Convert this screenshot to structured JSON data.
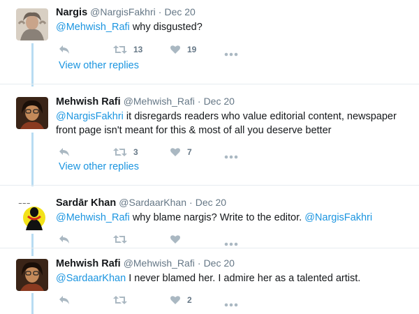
{
  "tweets": [
    {
      "name": "Nargis",
      "handle": "@NargisFakhri",
      "date": "Dec 20",
      "text_mention": "@Mehwish_Rafi",
      "text_rest": " why disgusted?",
      "retweets": "13",
      "likes": "19",
      "avatar_color": "#c9b8a6"
    },
    {
      "name": "Mehwish Rafi",
      "handle": "@Mehwish_Rafi",
      "date": "Dec 20",
      "text_mention": "@NargisFakhri",
      "text_rest": " it disregards readers who value editorial content, newspaper front page isn't meant for this & most of all you deserve better",
      "retweets": "3",
      "likes": "7",
      "avatar_color": "#6b4226"
    },
    {
      "name": "Sardār Khan",
      "handle": "@SardaarKhan",
      "date": "Dec 20",
      "text_mention": "@Mehwish_Rafi",
      "text_mid": " why blame nargis? Write to the editor. ",
      "text_mention2": "@NargisFakhri",
      "retweets": "",
      "likes": "",
      "avatar_color": "#f2e21a"
    },
    {
      "name": "Mehwish Rafi",
      "handle": "@Mehwish_Rafi",
      "date": "Dec 20",
      "text_mention": "@SardaarKhan",
      "text_rest": " I never blamed her. I admire her as a talented artist.",
      "retweets": "",
      "likes": "2",
      "avatar_color": "#6b4226"
    }
  ],
  "view_other_replies": "View other replies",
  "dot": "·",
  "colors": {
    "link": "#1b95e0",
    "muted": "#657786",
    "icon": "#aab8c2",
    "thread_line": "#b8dcf2"
  }
}
